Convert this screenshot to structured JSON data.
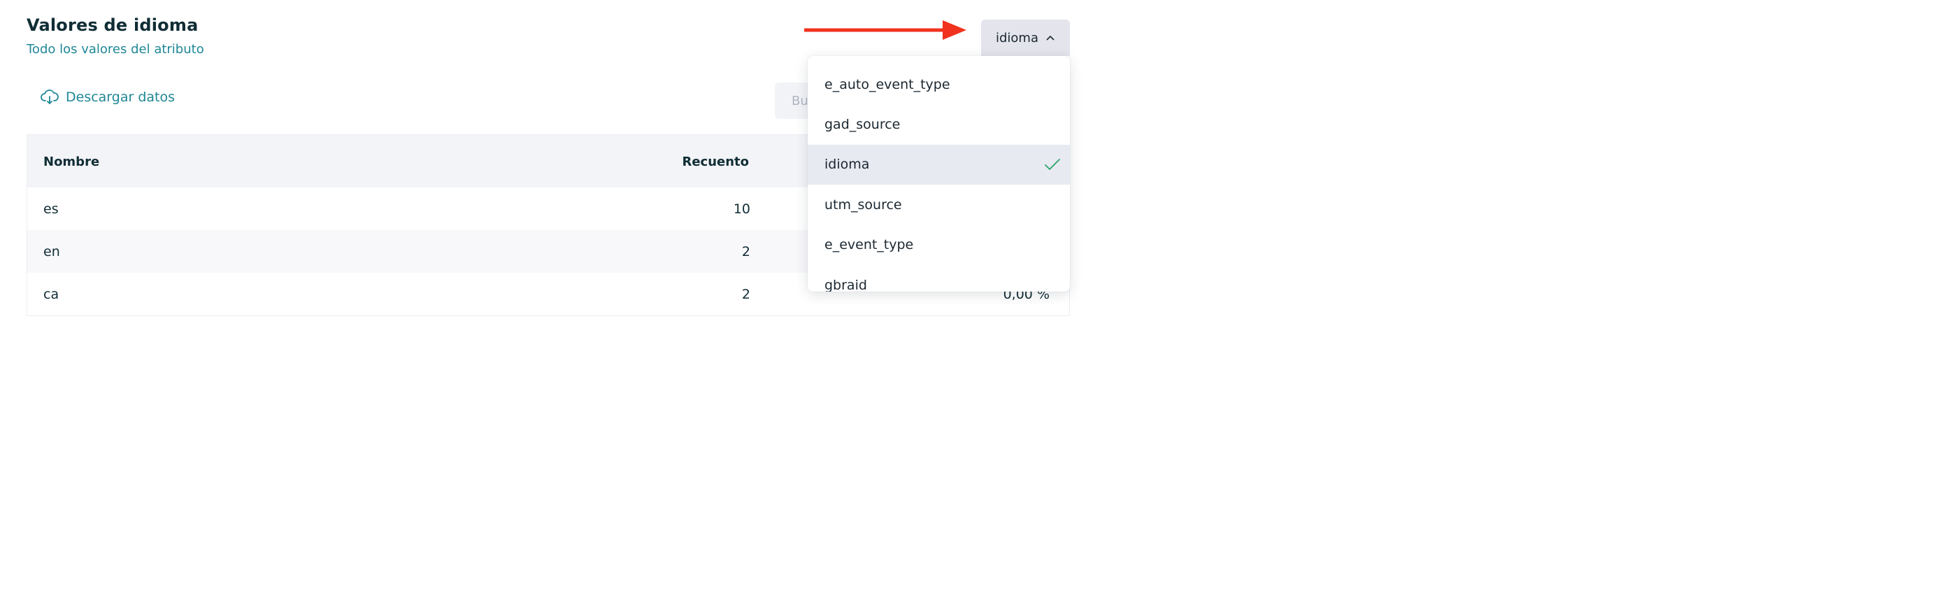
{
  "header": {
    "title": "Valores de idioma",
    "subtitle": "Todo los valores del atributo"
  },
  "attribute_select": {
    "selected": "idioma",
    "icon": "chevron-up-icon"
  },
  "toolbar": {
    "download_label": "Descargar datos",
    "download_icon": "cloud-download-icon",
    "search_placeholder": "Buscar"
  },
  "table": {
    "columns": [
      "Nombre",
      "Recuento"
    ],
    "rows": [
      {
        "name": "es",
        "count": "10",
        "pct": ""
      },
      {
        "name": "en",
        "count": "2",
        "pct": ""
      },
      {
        "name": "ca",
        "count": "2",
        "pct": "0,00 %"
      }
    ]
  },
  "dropdown": {
    "options": [
      {
        "label": "e_auto_event_type",
        "selected": false
      },
      {
        "label": "gad_source",
        "selected": false
      },
      {
        "label": "idioma",
        "selected": true
      },
      {
        "label": "utm_source",
        "selected": false
      },
      {
        "label": "e_event_type",
        "selected": false
      },
      {
        "label": "gbraid",
        "selected": false
      }
    ]
  },
  "annotation": {
    "arrow_color": "#f0321e"
  },
  "colors": {
    "accent": "#1f8796",
    "check": "#2aa36b",
    "selected_bg": "#e8eaf1"
  }
}
